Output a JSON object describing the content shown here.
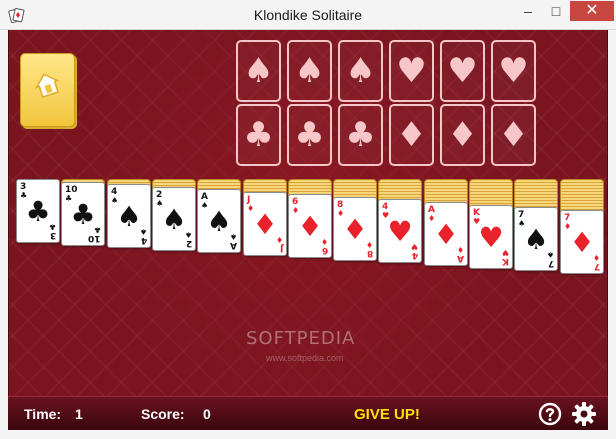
{
  "window": {
    "title": "Klondike Solitaire",
    "minimize_glyph": "–",
    "maximize_glyph": "□",
    "close_glyph": "✕"
  },
  "stock": {
    "icon": "card-back-house-icon"
  },
  "foundations": [
    {
      "suit": "♠",
      "suit_name": "spades",
      "color": "#f6c6c8"
    },
    {
      "suit": "♠",
      "suit_name": "spades",
      "color": "#f6c6c8"
    },
    {
      "suit": "♠",
      "suit_name": "spades",
      "color": "#f6c6c8"
    },
    {
      "suit": "♥",
      "suit_name": "hearts",
      "color": "#f6c6c8"
    },
    {
      "suit": "♥",
      "suit_name": "hearts",
      "color": "#f6c6c8"
    },
    {
      "suit": "♥",
      "suit_name": "hearts",
      "color": "#f6c6c8"
    },
    {
      "suit": "♣",
      "suit_name": "clubs",
      "color": "#f6c6c8"
    },
    {
      "suit": "♣",
      "suit_name": "clubs",
      "color": "#f6c6c8"
    },
    {
      "suit": "♣",
      "suit_name": "clubs",
      "color": "#f6c6c8"
    },
    {
      "suit": "♦",
      "suit_name": "diamonds",
      "color": "#f6c6c8"
    },
    {
      "suit": "♦",
      "suit_name": "diamonds",
      "color": "#f6c6c8"
    },
    {
      "suit": "♦",
      "suit_name": "diamonds",
      "color": "#f6c6c8"
    }
  ],
  "tableau": [
    {
      "rank": "3",
      "suit": "♣",
      "color": "black",
      "hidden_cards": 0
    },
    {
      "rank": "10",
      "suit": "♣",
      "color": "black",
      "hidden_cards": 1
    },
    {
      "rank": "4",
      "suit": "♠",
      "color": "black",
      "hidden_cards": 2
    },
    {
      "rank": "2",
      "suit": "♠",
      "color": "black",
      "hidden_cards": 3
    },
    {
      "rank": "A",
      "suit": "♠",
      "color": "black",
      "hidden_cards": 4
    },
    {
      "rank": "J",
      "suit": "♦",
      "color": "red",
      "hidden_cards": 5
    },
    {
      "rank": "6",
      "suit": "♦",
      "color": "red",
      "hidden_cards": 6
    },
    {
      "rank": "8",
      "suit": "♦",
      "color": "red",
      "hidden_cards": 7
    },
    {
      "rank": "4",
      "suit": "♥",
      "color": "red",
      "hidden_cards": 8
    },
    {
      "rank": "A",
      "suit": "♦",
      "color": "red",
      "hidden_cards": 9
    },
    {
      "rank": "K",
      "suit": "♥",
      "color": "red",
      "hidden_cards": 10
    },
    {
      "rank": "7",
      "suit": "♠",
      "color": "black",
      "hidden_cards": 11
    },
    {
      "rank": "7",
      "suit": "♦",
      "color": "red",
      "hidden_cards": 12
    }
  ],
  "watermark": {
    "main": "SOFTPEDIA",
    "sub": "www.softpedia.com"
  },
  "status": {
    "time_label": "Time:",
    "time_value": "1",
    "score_label": "Score:",
    "score_value": "0",
    "give_up": "GIVE UP!",
    "help_icon": "help-icon",
    "settings_icon": "gear-icon"
  },
  "colors": {
    "felt": "#7a1520",
    "card_back": "#f2c63d",
    "give_up": "#ffe100",
    "red_suit": "#e8212a"
  }
}
